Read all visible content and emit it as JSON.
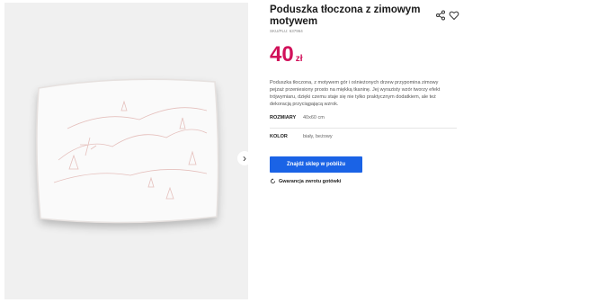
{
  "product": {
    "title": "Poduszka tłoczona z zimowym motywem",
    "sku": "SKU/PLU: 637964",
    "price_value": "40",
    "price_currency": "zł",
    "description": "Poduszka tłoczona, z motywem gór i ośnieżonych drzew przypomina zimowy pejzaż przeniesiony prosto na miękką tkaninę. Jej wyrazisty wzór tworzy efekt trójwymiaru, dzięki czemu staje się nie tylko praktycznym dodatkiem, ale też dekoracją przyciągającą wzrok.",
    "attributes": [
      {
        "label": "ROZMIARY",
        "value": "40x60 cm"
      },
      {
        "label": "KOLOR",
        "value": "biały, beżowy"
      }
    ],
    "cta_label": "Znajdź sklep w pobliżu",
    "guarantee_label": "Gwarancja zwrotu gotówki"
  },
  "colors": {
    "price": "#d1115a",
    "cta": "#1a63e6",
    "image_bg": "#f0f0f0"
  },
  "icons": {
    "share": "share-icon",
    "favorite": "heart-icon",
    "next": "chevron-right-icon",
    "guarantee": "refresh-icon"
  }
}
